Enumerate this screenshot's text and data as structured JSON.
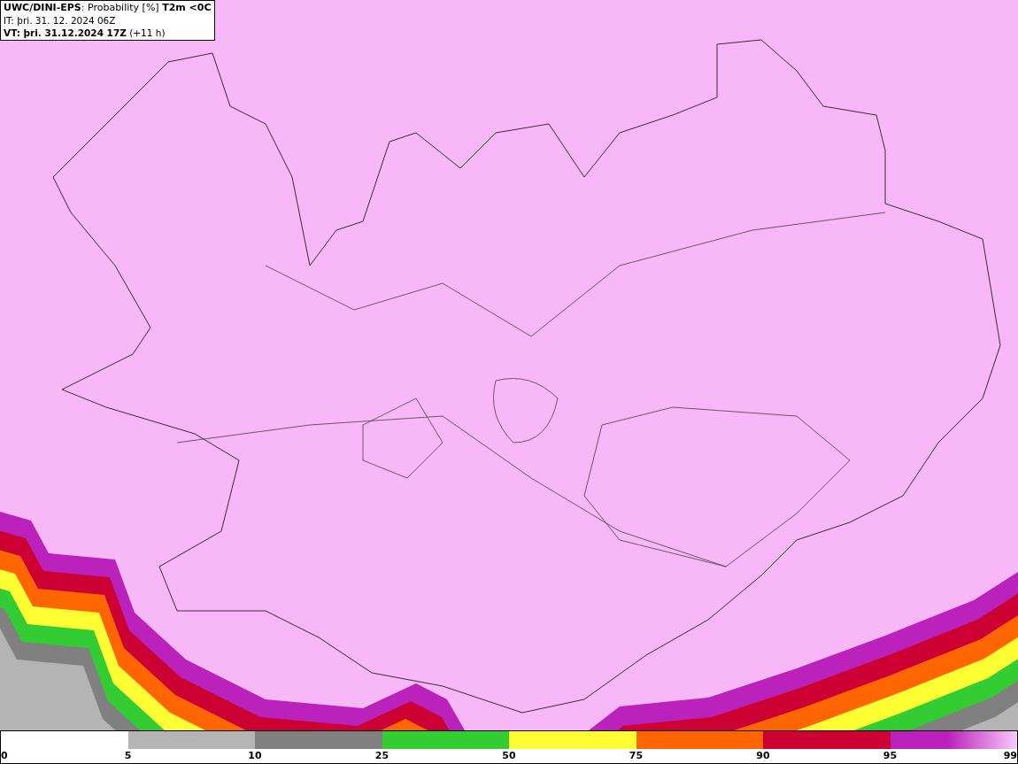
{
  "title_box": {
    "lines": [
      "**UWC/DINI-EPS**: Probability [%] **T2m <0C**",
      "IT: þri. 31. 12. 2024 06Z",
      "**VT: þri. 31.12.2024 17Z** (+11 h)"
    ]
  },
  "legend": {
    "segments": [
      {
        "color": "#b4b4b4"
      },
      {
        "color": "#808080"
      },
      {
        "color": "#33cc33"
      },
      {
        "color": "#ffff33"
      },
      {
        "color": "#ff6600"
      },
      {
        "color": "#cc0033"
      },
      {
        "color": "#bb22bb"
      }
    ],
    "ticks": [
      "0",
      "5",
      "10",
      "25",
      "50",
      "75",
      "90",
      "95",
      "99"
    ]
  }
}
